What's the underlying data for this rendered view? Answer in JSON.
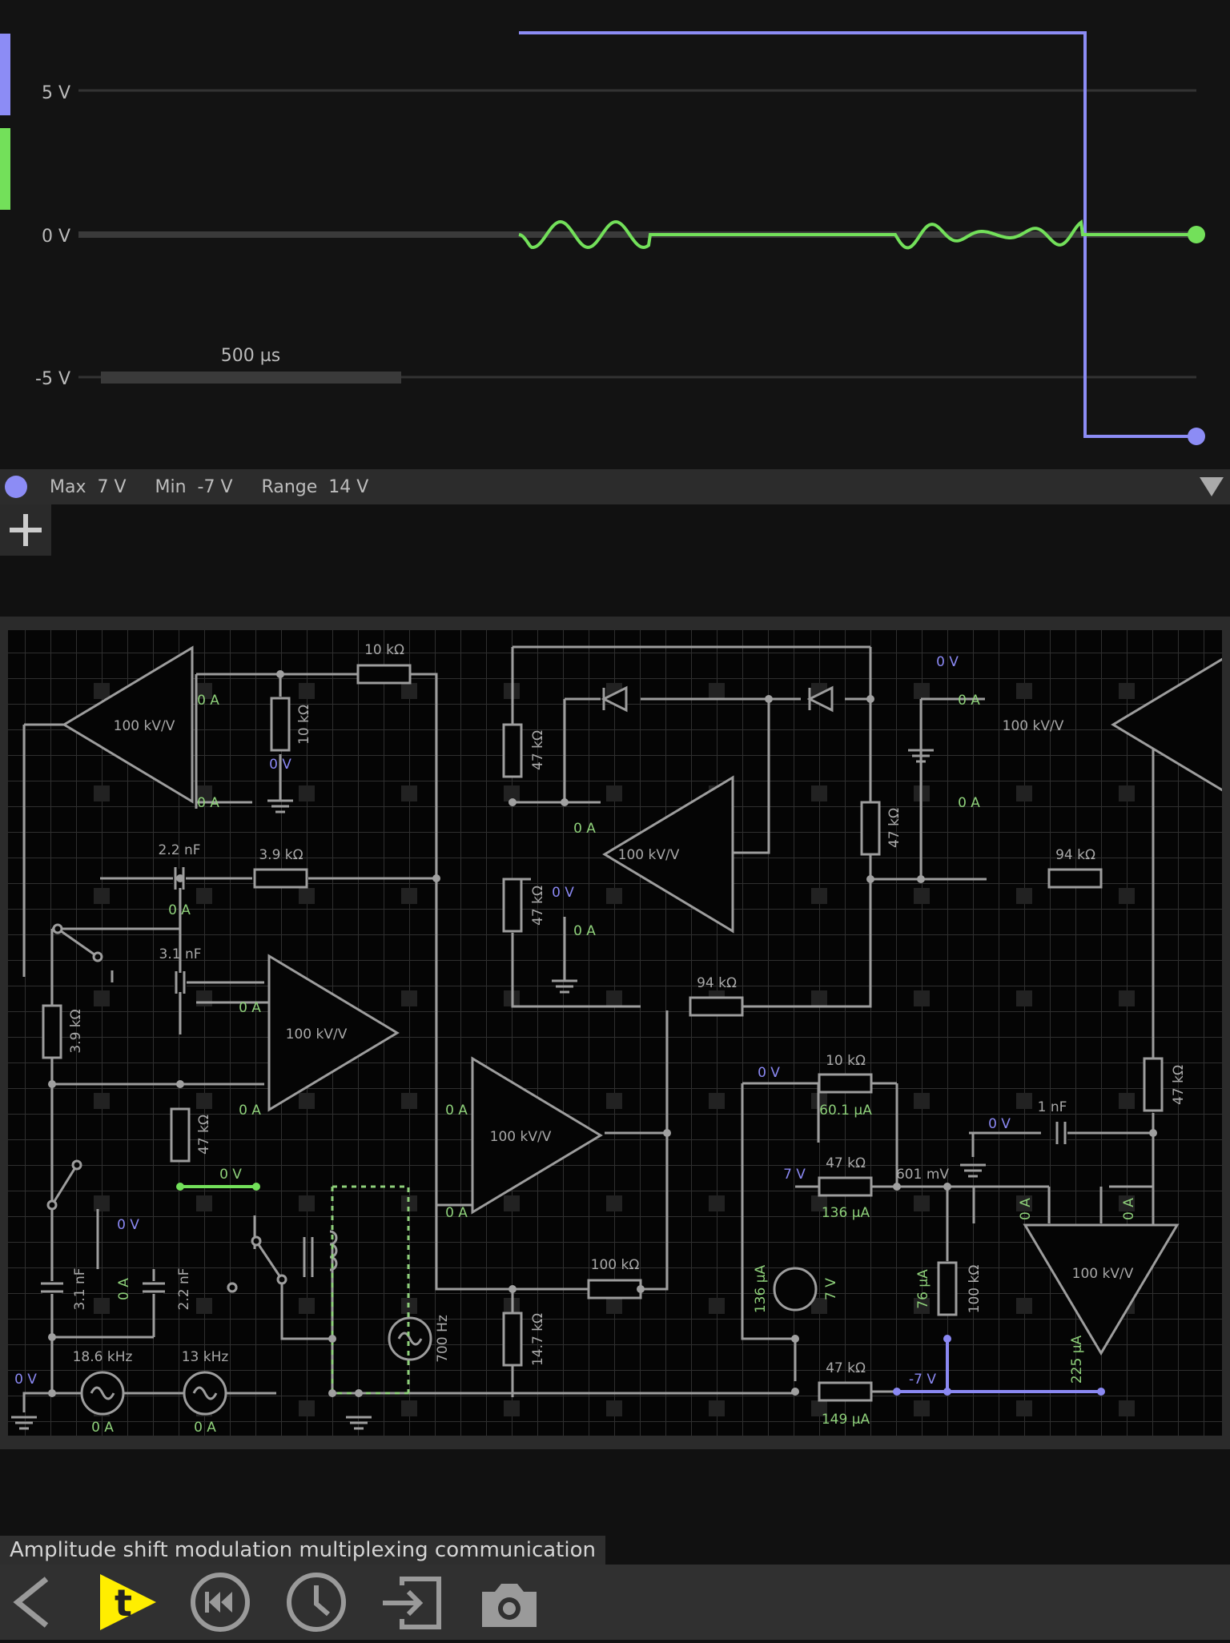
{
  "scope": {
    "y_labels": [
      "5 V",
      "0 V",
      "-5 V"
    ],
    "time_scale": "500 µs",
    "channel_colors": {
      "channel1": "#8c8cf5",
      "channel2": "#73e05a"
    },
    "stats": {
      "max": "Max  7 V",
      "min": "Min  -7 V",
      "range": "Range  14 V"
    }
  },
  "chart_data": {
    "type": "line",
    "ylabel": "",
    "ylim": [
      -7,
      9
    ],
    "y_ticks": [
      "5 V",
      "0 V",
      "-5 V"
    ],
    "series": [
      {
        "color": "#8c8cf5",
        "points": [
          [
            0,
            7
          ],
          [
            0.548,
            7
          ],
          [
            0.548,
            -7
          ],
          [
            0.6,
            -7
          ]
        ]
      },
      {
        "color": "#73e05a",
        "description": "0 V baseline with two short sinusoidal bursts",
        "points": [
          [
            0,
            0
          ],
          [
            0.6,
            0
          ]
        ]
      }
    ]
  },
  "add_label": "+",
  "circuit": {
    "labels": {
      "r_top": "10 kΩ",
      "r_top_v": "10 kΩ",
      "opamp1": "100 kV/V",
      "opamp1_plus_current": "0 A",
      "opamp1_minus_current": "0 A",
      "opamp1_ground_v": "0 V",
      "cap1": "2.2 nF",
      "cap1_current": "0 A",
      "r_39a": "3.9 kΩ",
      "cap2": "3.1 nF",
      "opamp2": "100 kV/V",
      "opamp2_minus_current": "0 A",
      "opamp2_plus_current": "0 A",
      "r_39b": "3.9 kΩ",
      "r_47a": "47 kΩ",
      "node_v": "0 V",
      "cap3": "3.1 nF",
      "cap4_v": "0 V",
      "cap4_current": "0 A",
      "cap4": "2.2 nF",
      "src1": "18.6 kHz",
      "src1_current": "0 A",
      "src2": "13 kHz",
      "src2_current": "0 A",
      "ground_v": "0 V",
      "src3": "700 Hz",
      "r_47b": "47 kΩ",
      "r_47c": "47 kΩ",
      "opamp3": "100 kV/V",
      "opamp3_minus_current": "0 A",
      "opamp3_plus_current": "0 A",
      "opamp3_v": "0 V",
      "r_47d": "47 kΩ",
      "r_94a": "94 kΩ",
      "opamp4": "100 kV/V",
      "opamp4_plus_current": "0 A",
      "opamp4_minus_current": "0 A",
      "r_100a": "100 kΩ",
      "r_147": "14.7 kΩ",
      "opamp5": "100 kV/V",
      "opamp5_v": "0 V",
      "opamp5_plus_current": "0 A",
      "opamp5_minus_current": "0 A",
      "r_94b": "94 kΩ",
      "r_10b": "10 kΩ",
      "r_10b_v": "0 V",
      "r_10b_current": "60.1 µA",
      "r_47e": "47 kΩ",
      "r_47e_v": "7 V",
      "r_47e_current": "136 µA",
      "node_601": "601 mV",
      "vsrc": "7 V",
      "vsrc_current": "136 µA",
      "r_100b": "100 kΩ",
      "r_100b_current": "76 µA",
      "r_47f": "47 kΩ",
      "r_47f_current": "149 µA",
      "neg_v": "-7 V",
      "cap5": "1 nF",
      "cap5_v": "0 V",
      "r_47g": "47 kΩ",
      "opamp6": "100 kV/V",
      "opamp6_left_current": "0 A",
      "opamp6_right_current": "0 A",
      "opamp6_out_current": "225 µA"
    }
  },
  "title": "Amplitude shift modulation multiplexing communication",
  "toolbar": {
    "icons": [
      "back-icon",
      "t-tool-icon",
      "rewind-icon",
      "clock-icon",
      "import-icon",
      "camera-icon"
    ],
    "accent": "#ffee00"
  }
}
